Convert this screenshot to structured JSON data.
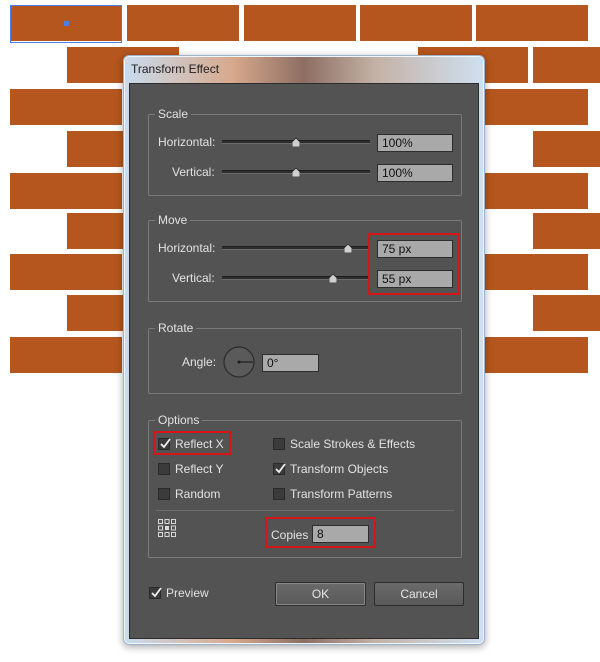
{
  "dialog": {
    "title": "Transform Effect",
    "scale": {
      "title": "Scale",
      "horizontal_label": "Horizontal:",
      "horizontal_value": "100%",
      "horizontal_fraction": 0.5,
      "vertical_label": "Vertical:",
      "vertical_value": "100%",
      "vertical_fraction": 0.5
    },
    "move": {
      "title": "Move",
      "horizontal_label": "Horizontal:",
      "horizontal_value": "75 px",
      "horizontal_fraction": 0.85,
      "vertical_label": "Vertical:",
      "vertical_value": "55 px",
      "vertical_fraction": 0.75
    },
    "rotate": {
      "title": "Rotate",
      "angle_label": "Angle:",
      "angle_value": "0°"
    },
    "options": {
      "title": "Options",
      "reflect_x": {
        "label": "Reflect X",
        "checked": true
      },
      "reflect_y": {
        "label": "Reflect Y",
        "checked": false
      },
      "random": {
        "label": "Random",
        "checked": false
      },
      "scale_strokes": {
        "label": "Scale Strokes & Effects",
        "checked": false
      },
      "transform_objects": {
        "label": "Transform Objects",
        "checked": true
      },
      "transform_patterns": {
        "label": "Transform Patterns",
        "checked": false
      },
      "copies_label": "Copies",
      "copies_value": "8"
    },
    "preview": {
      "label": "Preview",
      "checked": true
    },
    "ok_label": "OK",
    "cancel_label": "Cancel"
  },
  "colors": {
    "brick": "#b5561e",
    "dialog_bg": "#535353",
    "highlight": "#d4161b",
    "selection": "#4d7fe0"
  }
}
